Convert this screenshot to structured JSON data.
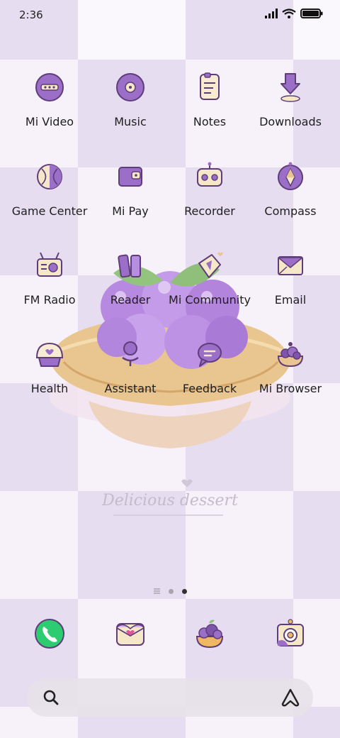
{
  "status_bar": {
    "time": "2:36",
    "icons": [
      "signal-icon",
      "wifi-icon",
      "battery-icon"
    ]
  },
  "wallpaper": {
    "caption": "Delicious dessert",
    "colors": {
      "check_dark": "#e6def0",
      "check_light": "#fbf8fd",
      "accent": "#9b6fc8"
    }
  },
  "apps": [
    {
      "label": "Mi Video",
      "icon": "video-icon"
    },
    {
      "label": "Music",
      "icon": "music-icon"
    },
    {
      "label": "Notes",
      "icon": "notes-icon"
    },
    {
      "label": "Downloads",
      "icon": "download-icon"
    },
    {
      "label": "Game Center",
      "icon": "game-icon"
    },
    {
      "label": "Mi Pay",
      "icon": "wallet-icon"
    },
    {
      "label": "Recorder",
      "icon": "recorder-icon"
    },
    {
      "label": "Compass",
      "icon": "compass-icon"
    },
    {
      "label": "FM Radio",
      "icon": "radio-icon"
    },
    {
      "label": "Reader",
      "icon": "book-icon"
    },
    {
      "label": "Mi Community",
      "icon": "community-icon"
    },
    {
      "label": "Email",
      "icon": "mail-icon"
    },
    {
      "label": "Health",
      "icon": "health-icon"
    },
    {
      "label": "Assistant",
      "icon": "assistant-icon"
    },
    {
      "label": "Feedback",
      "icon": "feedback-icon"
    },
    {
      "label": "Mi Browser",
      "icon": "browser-icon"
    }
  ],
  "page_indicator": {
    "pages": 2,
    "current": 2
  },
  "dock": [
    {
      "name": "phone",
      "icon": "phone-icon"
    },
    {
      "name": "messages",
      "icon": "message-icon"
    },
    {
      "name": "themes",
      "icon": "themes-icon"
    },
    {
      "name": "camera",
      "icon": "camera-icon"
    }
  ],
  "search": {
    "icons": [
      "search-icon",
      "assistant-logo-icon"
    ]
  }
}
